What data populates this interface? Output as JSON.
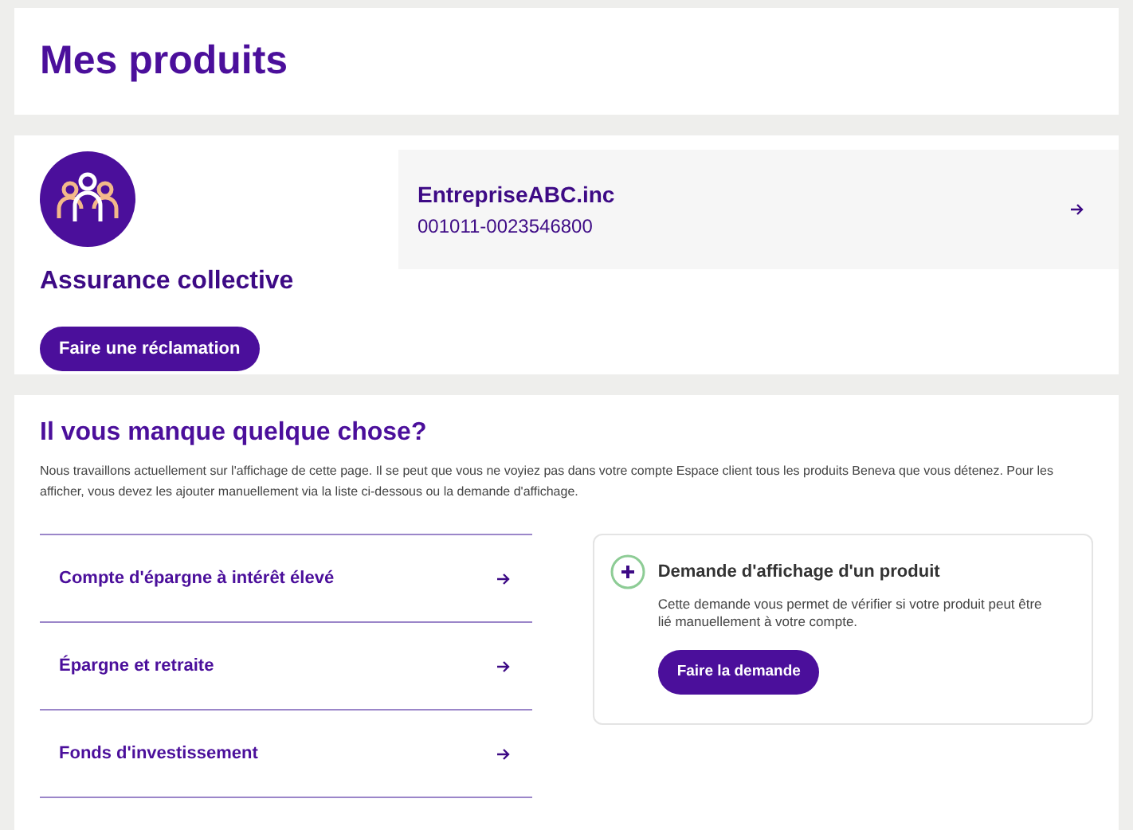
{
  "page_title": "Mes produits",
  "product": {
    "name": "Assurance collective",
    "button": "Faire une réclamation",
    "account": {
      "company": "EntrepriseABC.inc",
      "number": "001011-0023546800"
    }
  },
  "missing": {
    "title": "Il vous manque quelque chose?",
    "description": "Nous travaillons actuellement sur l'affichage de cette page. Il se peut que vous ne voyiez pas dans votre compte Espace client tous les produits Beneva que vous détenez. Pour les afficher, vous devez les ajouter manuellement via la liste ci-dessous ou la demande d'affichage.",
    "links": [
      "Compte d'épargne à intérêt élevé",
      "Épargne et retraite",
      "Fonds d'investissement"
    ],
    "request": {
      "title": "Demande d'affichage d'un produit",
      "text": "Cette demande vous permet de vérifier si votre produit peut être lié manuellement à votre compte.",
      "button": "Faire la demande"
    }
  }
}
